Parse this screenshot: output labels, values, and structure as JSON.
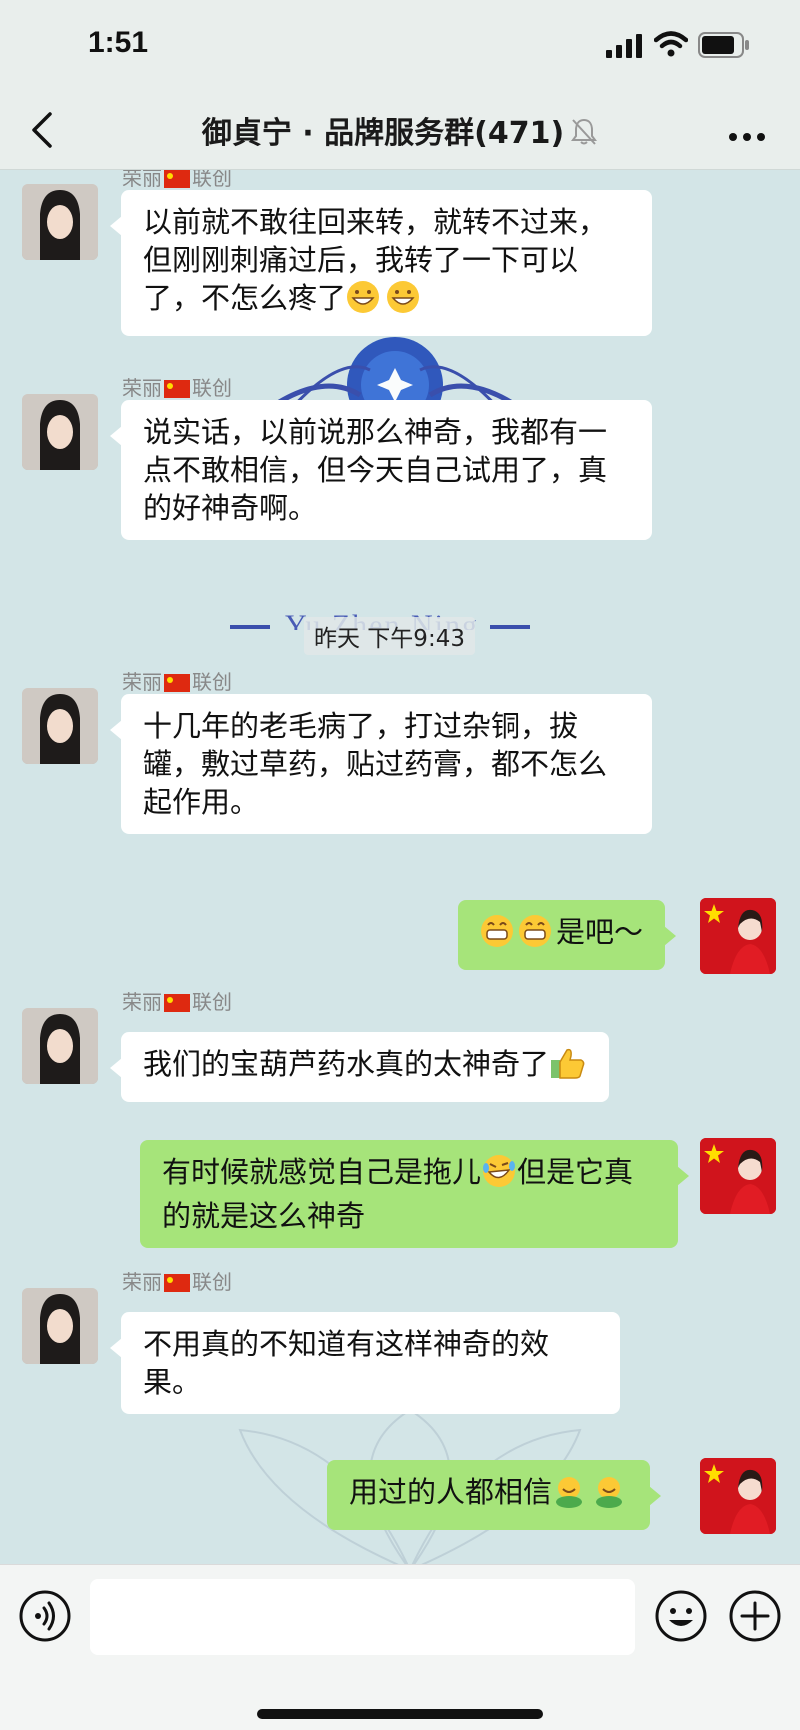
{
  "status_bar": {
    "time": "1:51"
  },
  "nav": {
    "title": "御貞宁 · 品牌服务群(471)"
  },
  "watermark": {
    "text": "Yu Zhen Ning"
  },
  "sender_name": "荣丽",
  "sender_suffix": "联创",
  "timestamp": "昨天 下午9:43",
  "messages": [
    {
      "text": "以前就不敢往回来转，就转不过来，但刚刚刺痛过后，我转了一下可以了，不怎么疼了"
    },
    {
      "text": "说实话，以前说那么神奇，我都有一点不敢相信，但今天自己试用了，真的好神奇啊。"
    },
    {
      "text": "十几年的老毛病了，打过杂铜，拔罐，敷过草药，贴过药膏，都不怎么起作用。"
    },
    {
      "text": "是吧～"
    },
    {
      "text": "我们的宝葫芦药水真的太神奇了"
    },
    {
      "text": "有时候就感觉自己是拖儿"
    },
    {
      "text": "但是它真的就是这么神奇"
    },
    {
      "text": "不用真的不知道有这样神奇的效果。"
    },
    {
      "text": "用过的人都相信"
    }
  ],
  "icons": {
    "back": "chevron-left-icon",
    "mute": "bell-off-icon",
    "more": "more-icon",
    "voice": "voice-icon",
    "emoji": "emoji-icon",
    "plus": "plus-icon"
  },
  "colors": {
    "outgoing_bubble": "#a6e47a",
    "incoming_bubble": "#ffffff",
    "background": "#d3e5e7"
  }
}
